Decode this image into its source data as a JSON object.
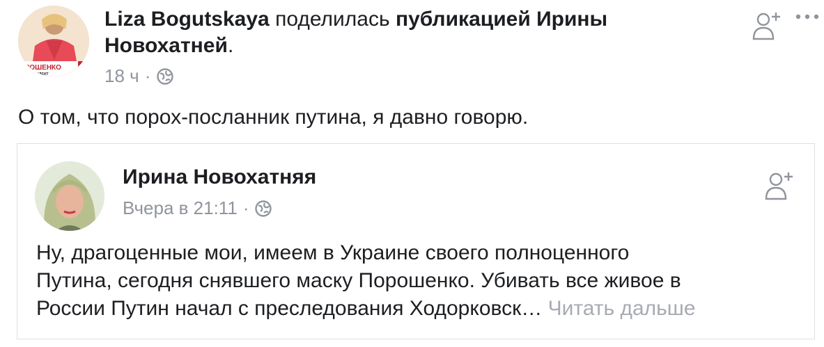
{
  "outer_post": {
    "author": "Liza Bogutskaya",
    "action_text": "поделилась",
    "object_text": "публикацией Ирины",
    "object_text_2": "Новохатней",
    "period": ".",
    "time": "18 ч",
    "separator": "·",
    "privacy_icon": "globe-icon",
    "text": "О том, что порох-посланник путина, я давно говорю.",
    "avatar_badge_text": "ОРОШЕНКО",
    "avatar_badge_sub": "Й ПРЕЗИДЕНТ"
  },
  "shared_post": {
    "author": "Ирина Новохатняя",
    "time": "Вчера в 21:11",
    "separator": "·",
    "privacy_icon": "globe-icon",
    "text_line1": "Ну, драгоценные мои, имеем в Украине своего полноценного",
    "text_line2": "Путина, сегодня снявшего маску Порошенко. Убивать все живое в",
    "text_line3": "России Путин начал с преследования Ходорковск…",
    "see_more": "Читать дальше"
  },
  "icons": {
    "follow": "add-friend-icon",
    "more": "more-options-icon"
  },
  "colors": {
    "text": "#1c1e21",
    "meta": "#90949c",
    "see_more": "#a7abb2",
    "border": "#dddfe2"
  }
}
